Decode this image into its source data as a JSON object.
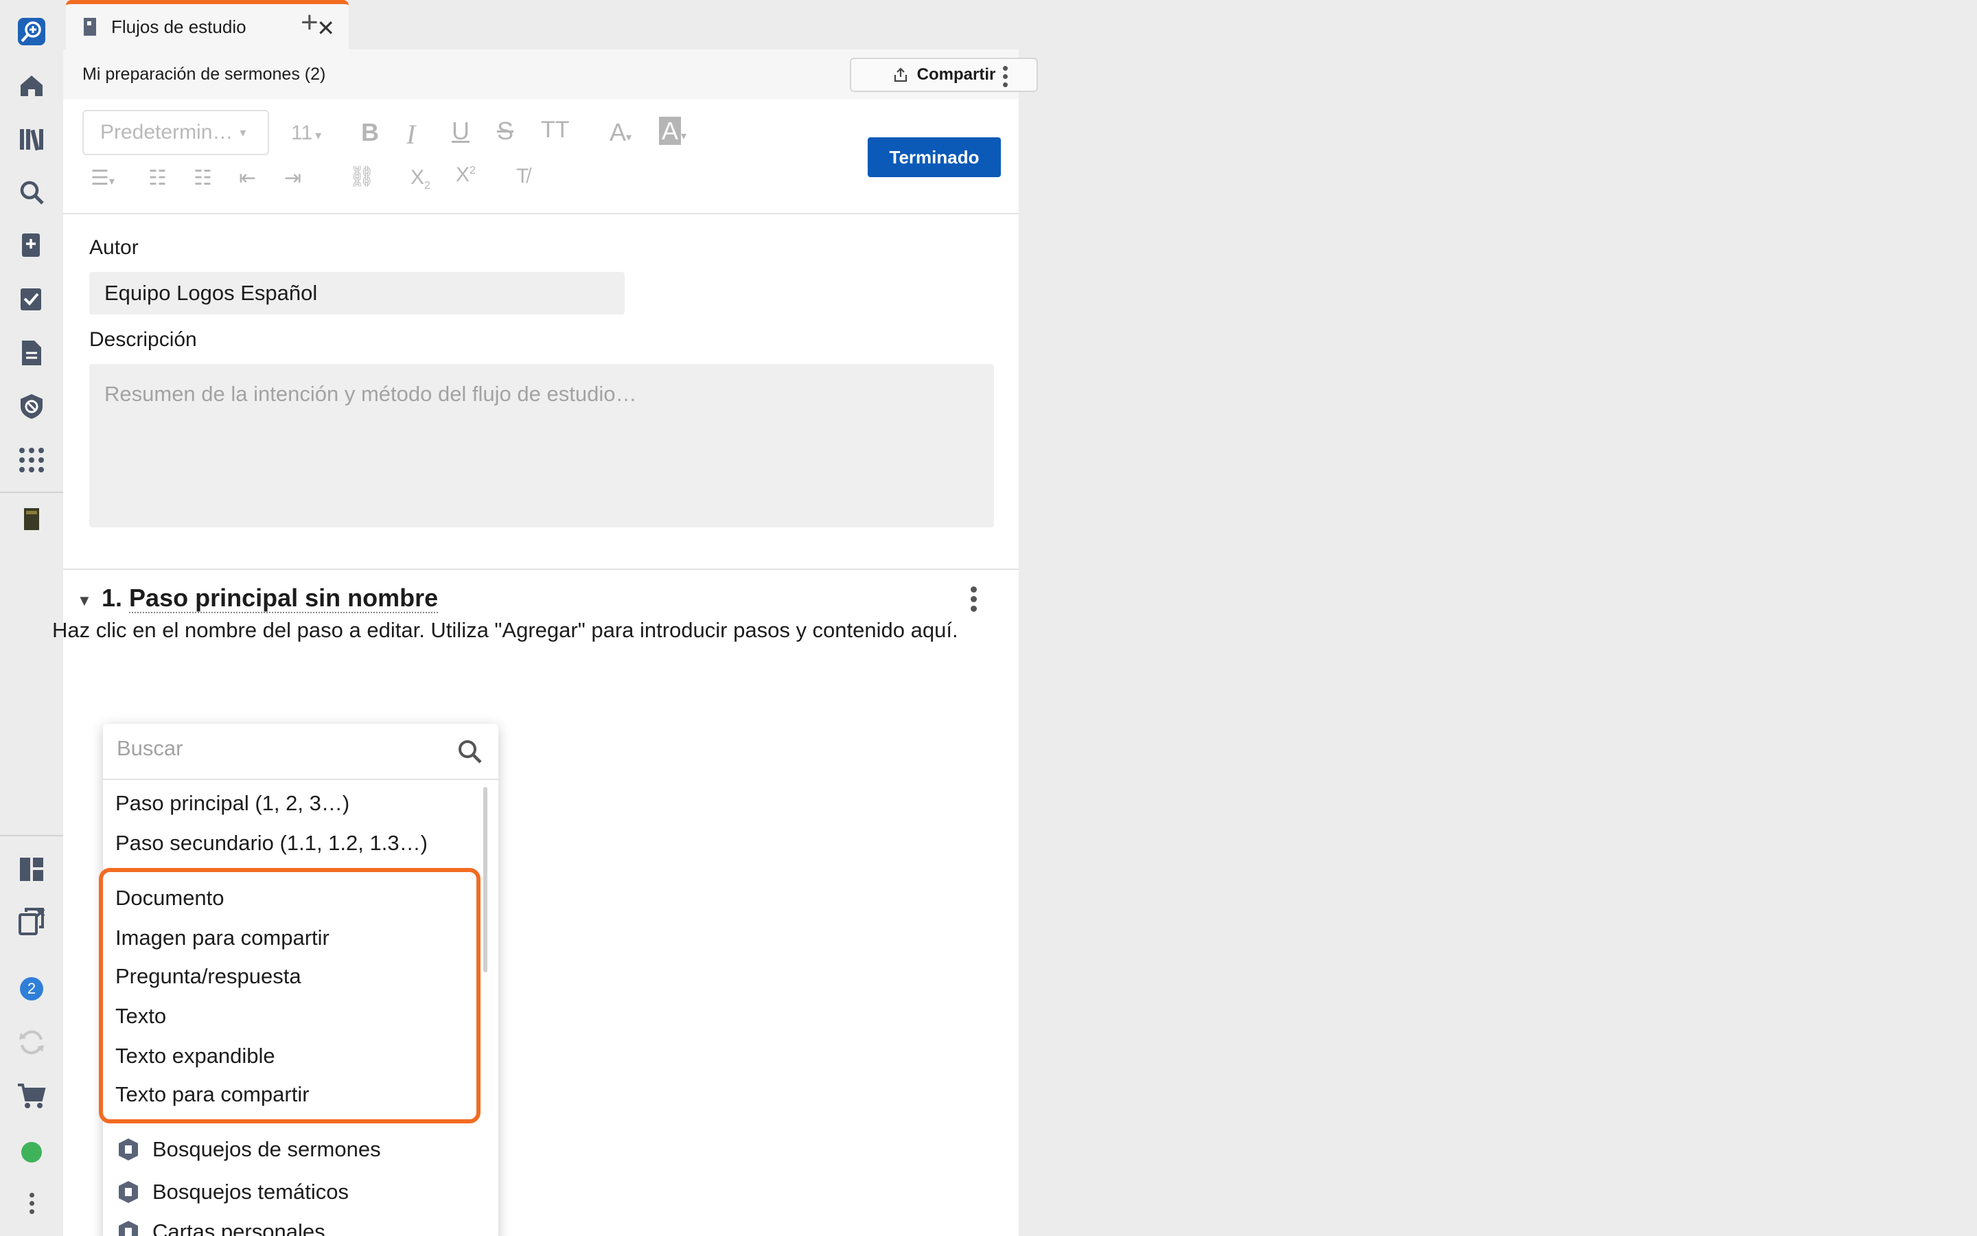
{
  "rail": {
    "icons": [
      "logos-search-logo-icon",
      "home-icon",
      "library-icon",
      "search-icon",
      "add-document-icon",
      "checklist-icon",
      "document-icon",
      "shield-icon",
      "apps-grid-icon",
      "book-cover-icon",
      "layout-icon",
      "close-copy-icon",
      "notification-icon",
      "sync-icon",
      "cart-icon",
      "user-icon",
      "more-icon"
    ],
    "badge_count": "2",
    "accent": "#2f7fd8"
  },
  "tab": {
    "label": "Flujos de estudio",
    "close": "✕",
    "new": "+",
    "accent": "#f26c22"
  },
  "panel": {
    "title": "Mi preparación de sermones (2)",
    "share_label": "Compartir"
  },
  "toolbar": {
    "style_select": "Predetermin…",
    "font_size": "11",
    "done_label": "Terminado",
    "done_color": "#0b5ab8"
  },
  "form": {
    "author_label": "Autor",
    "author_value": "Equipo Logos Español",
    "description_label": "Descripción",
    "description_placeholder": "Resumen de la intención y método del flujo de estudio…"
  },
  "step": {
    "number": "1.",
    "name": "Paso principal sin nombre",
    "help": "Haz clic en el nombre del paso a editar. Utiliza \"Agregar\" para introducir pasos y contenido aquí."
  },
  "dropdown": {
    "search_placeholder": "Buscar",
    "step_items": [
      "Paso principal (1, 2, 3…)",
      "Paso secundario (1.1, 1.2, 1.3…)"
    ],
    "content_items": [
      "Documento",
      "Imagen para compartir",
      "Pregunta/respuesta",
      "Texto",
      "Texto expandible",
      "Texto para compartir"
    ],
    "resource_items": [
      "Bosquejos de sermones",
      "Bosquejos temáticos",
      "Cartas personales"
    ],
    "highlight_color": "#f26c22"
  }
}
